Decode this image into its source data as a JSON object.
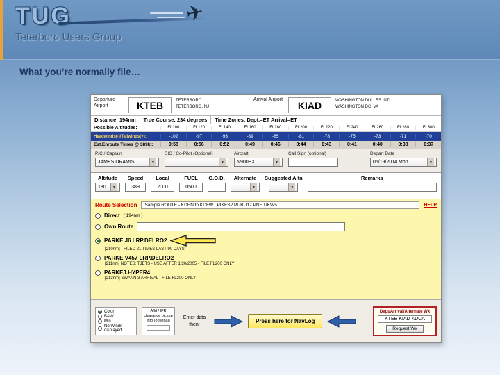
{
  "slide": {
    "title": "What you’re normally file…",
    "logo": {
      "acronym": "TUG",
      "name": "Teterboro Users Group"
    }
  },
  "app": {
    "header": {
      "departure": {
        "label": "Departure Airport",
        "code": "KTEB",
        "line1": "TETERBORO",
        "line2": "TETERBORO, NJ"
      },
      "arrival": {
        "label": "Arrival Airport",
        "code": "KIAD",
        "line1": "WASHINGTON DULLES INTL",
        "line2": "WASHINGTON DC, VA"
      },
      "distance": "Distance: 194nm",
      "true_course": "True Course: 234 degrees",
      "time_zones": "Time Zones: Dept.=ET   Arrival=ET",
      "altitudes_label": "Possible Altitudes:",
      "altitudes": [
        "FL100",
        "FL120",
        "FL140",
        "FL160",
        "FL180",
        "FL200",
        "FL220",
        "FL240",
        "FL260",
        "FL280",
        "FL300"
      ],
      "winds_label": "Headwinds(-)/Tailwinds(+):",
      "winds": [
        "-102",
        "-97",
        "-93",
        "-89",
        "-85",
        "-81",
        "-78",
        "-75",
        "-73",
        "-71",
        "-70"
      ],
      "times_label": "Est.Enroute Times @ 389kt:",
      "times": [
        "0:58",
        "0:56",
        "0:52",
        "0:49",
        "0:46",
        "0:44",
        "0:43",
        "0:41",
        "0:40",
        "0:38",
        "0:37"
      ]
    },
    "crew": {
      "captain_label": "P/C / Captain",
      "captain_value": "JAMES DRAMIS",
      "sic_label": "SIC / Co-Pilot (Optional)",
      "sic_value": "",
      "aircraft_label": "Aircraft",
      "aircraft_value": "N900EX",
      "callsign_label": "Call Sign (optional)",
      "callsign_value": "",
      "date_label": "Depart Date",
      "date_value": "05/19/2014 Mon"
    },
    "flight": {
      "altitude_label": "Altitude",
      "altitude_value": "180",
      "speed_label": "Speed",
      "speed_value": "389",
      "local_label": "Local",
      "local_value": "2000",
      "fuel_label": "FUEL",
      "fuel_value": "0500",
      "god_label": "G.O.D.",
      "god_value": "",
      "alternate_label": "Alternate",
      "alternate_value": "",
      "suggested_label": "Suggested Altn",
      "suggested_value": "",
      "remarks_label": "Remarks",
      "remarks_value": ""
    },
    "route": {
      "title": "Route Selection",
      "sample": "Sample ROUTE - KDEN to KDFW :  PIKES2.PUB J17 PNH.UKW5",
      "help": "HELP",
      "options": [
        {
          "label": "Direct",
          "extra": "( 194nm )"
        },
        {
          "label": "Own Route"
        },
        {
          "label": "PARKE J6 LRP.DELRO2",
          "note": "[210nm] - FILED 21 TIMES LAST 90 DAYS"
        },
        {
          "label": "PARKE V457 LRP.DELRO2",
          "note": "[211nm]  NOTES: TJETS - USE AFTER 1/20/2005 - FILE FL200 ONLY"
        },
        {
          "label": "PARKEJ.HYPER4",
          "note": "[213nm]  SWANN 3 ARRIVAL - FILE FL200 ONLY"
        }
      ]
    },
    "bottom": {
      "display_options": [
        "Color",
        "B&W",
        "Min",
        "No Winds displayed"
      ],
      "ifr_text": "Afld / IFR clearance pickup info (optional)",
      "enter_text": "Enter data then:",
      "navlog_button": "Press here for NavLog",
      "wx_title": "Dept/Arrival/Alternate Wx",
      "wx_value": "KTEB KIAD KDCA",
      "wx_button": "Request Wx"
    }
  }
}
